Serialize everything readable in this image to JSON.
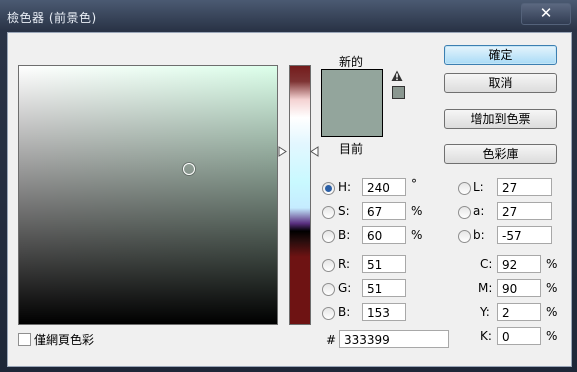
{
  "window": {
    "title": "檢色器 (前景色)",
    "close_label": "✕"
  },
  "swatch": {
    "new_label": "新的",
    "current_label": "目前",
    "color": "#93a59c"
  },
  "buttons": {
    "ok": "確定",
    "cancel": "取消",
    "add_to_swatches": "增加到色票",
    "color_libraries": "色彩庫"
  },
  "hsb": {
    "h": {
      "label": "H:",
      "value": "240",
      "unit": "°",
      "selected": true
    },
    "s": {
      "label": "S:",
      "value": "67",
      "unit": "%"
    },
    "b": {
      "label": "B:",
      "value": "60",
      "unit": "%"
    }
  },
  "rgb": {
    "r": {
      "label": "R:",
      "value": "51"
    },
    "g": {
      "label": "G:",
      "value": "51"
    },
    "b": {
      "label": "B:",
      "value": "153"
    }
  },
  "lab": {
    "l": {
      "label": "L:",
      "value": "27"
    },
    "a": {
      "label": "a:",
      "value": "27"
    },
    "b": {
      "label": "b:",
      "value": "-57"
    }
  },
  "cmyk": {
    "c": {
      "label": "C:",
      "value": "92",
      "unit": "%"
    },
    "m": {
      "label": "M:",
      "value": "90",
      "unit": "%"
    },
    "y": {
      "label": "Y:",
      "value": "2",
      "unit": "%"
    },
    "k": {
      "label": "K:",
      "value": "0",
      "unit": "%"
    }
  },
  "hex": {
    "label": "#",
    "value": "333399"
  },
  "web_only": {
    "label": "僅網頁色彩",
    "checked": false
  },
  "icons": {
    "warning": "gamut-warning-icon",
    "web_cube": "web-safe-cube-icon"
  }
}
